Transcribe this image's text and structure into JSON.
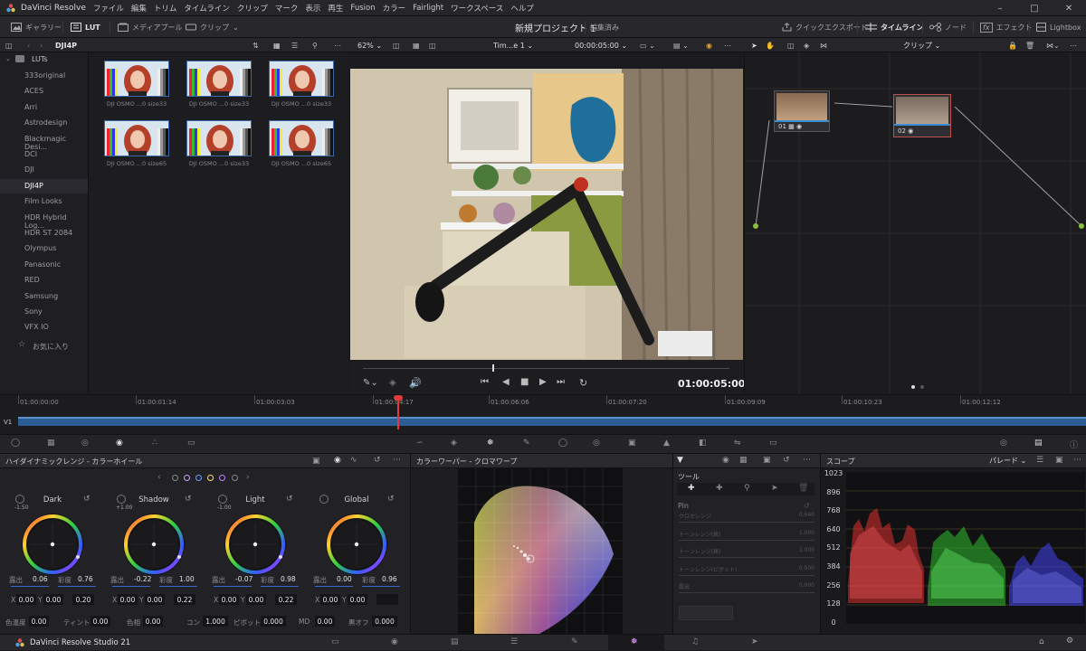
{
  "app": {
    "name": "DaVinci Resolve",
    "footer": "DaVinci Resolve Studio 21"
  },
  "menu": [
    "ファイル",
    "編集",
    "トリム",
    "タイムライン",
    "クリップ",
    "マーク",
    "表示",
    "再生",
    "Fusion",
    "カラー",
    "Fairlight",
    "ワークスペース",
    "ヘルプ"
  ],
  "toolbar": {
    "gallery": "ギャラリー",
    "lut": "LUT",
    "media_pool": "メディアプール",
    "clips": "クリップ",
    "project_name": "新規プロジェクト 1",
    "project_status": "編集済み",
    "quick_export": "クイックエクスポート",
    "timeline": "タイムライン",
    "nodes": "ノード",
    "effects": "エフェクト",
    "lightbox": "Lightbox"
  },
  "bar2": {
    "folder": "DJI4P",
    "zoom": "62%",
    "timeline_name": "Tim...e 1",
    "timecode": "00:00:05:00",
    "clip_mode": "クリップ"
  },
  "lut_tree": {
    "root": "LUTs",
    "items": [
      "333original",
      "ACES",
      "Arri",
      "Astrodesign",
      "Blackmagic Desi...",
      "DCI",
      "DJI",
      "DJI4P",
      "Film Looks",
      "HDR Hybrid Log...",
      "HDR ST 2084",
      "Olympus",
      "Panasonic",
      "RED",
      "Samsung",
      "Sony",
      "VFX IO"
    ],
    "selected": "DJI4P",
    "favorites": "お気に入り"
  },
  "luts": [
    {
      "caption": "DJI OSMO ...0 size33"
    },
    {
      "caption": "DJI OSMO ...0 size33"
    },
    {
      "caption": "DJI OSMO ...0 size33"
    },
    {
      "caption": "DJI OSMO ...0 size65"
    },
    {
      "caption": "DJI OSMO ...0 size33"
    },
    {
      "caption": "DJI OSMO ...0 size65"
    }
  ],
  "viewer": {
    "timecode": "01:00:05:00"
  },
  "nodes": [
    {
      "label": "01"
    },
    {
      "label": "02"
    }
  ],
  "timeline": {
    "track": "V1",
    "ticks": [
      "01:00:00:00",
      "01:00:01:14",
      "01:00:03:03",
      "01:00:04:17",
      "01:00:06:06",
      "01:00:07:20",
      "01:00:09:09",
      "01:00:10:23",
      "01:00:12:12"
    ]
  },
  "wheels_panel": {
    "title": "ハイダイナミックレンジ - カラーホイール",
    "wheels": [
      {
        "name": "Dark",
        "badge": "-1.50",
        "exposure": "0.06",
        "saturation": "0.76",
        "x": "0.00",
        "y": "0.00",
        "z": "0.20"
      },
      {
        "name": "Shadow",
        "badge": "+1.00",
        "exposure": "-0.22",
        "saturation": "1.00",
        "x": "0.00",
        "y": "0.00",
        "z": "0.22"
      },
      {
        "name": "Light",
        "badge": "-1.00",
        "exposure": "-0.07",
        "saturation": "0.98",
        "x": "0.00",
        "y": "0.00",
        "z": "0.22"
      },
      {
        "name": "Global",
        "badge": "",
        "exposure": "0.00",
        "saturation": "0.96",
        "x": "0.00",
        "y": "0.00",
        "z": ""
      }
    ],
    "keys": {
      "exposure": "露出",
      "saturation": "彩度",
      "x": "X",
      "y": "Y"
    },
    "bottom": [
      {
        "label": "色温度",
        "value": "0.00"
      },
      {
        "label": "ティント",
        "value": "0.00"
      },
      {
        "label": "色相",
        "value": "0.00"
      },
      {
        "label": "コン",
        "value": "1.000"
      },
      {
        "label": "ピボット",
        "value": "0.000"
      },
      {
        "label": "MD",
        "value": "0.00"
      },
      {
        "label": "黒オフ",
        "value": "0.000"
      }
    ]
  },
  "colorwarper": {
    "title": "カラーワーパー - クロマワープ"
  },
  "tools_panel": {
    "title": "ツール",
    "pin": "Pin",
    "sliders": [
      {
        "name": "ウロセレンジ",
        "value": "0.640"
      },
      {
        "name": "トーンレンジ(高)",
        "value": "1.000"
      },
      {
        "name": "トーンレンジ(高)",
        "value": "1.000"
      },
      {
        "name": "トーンレンジ(ピボット)",
        "value": "0.500"
      },
      {
        "name": "露出",
        "value": "0.000"
      }
    ]
  },
  "scope": {
    "title": "スコープ",
    "mode": "パレード",
    "scale": [
      "1023",
      "896",
      "768",
      "640",
      "512",
      "384",
      "256",
      "128",
      "0"
    ]
  }
}
